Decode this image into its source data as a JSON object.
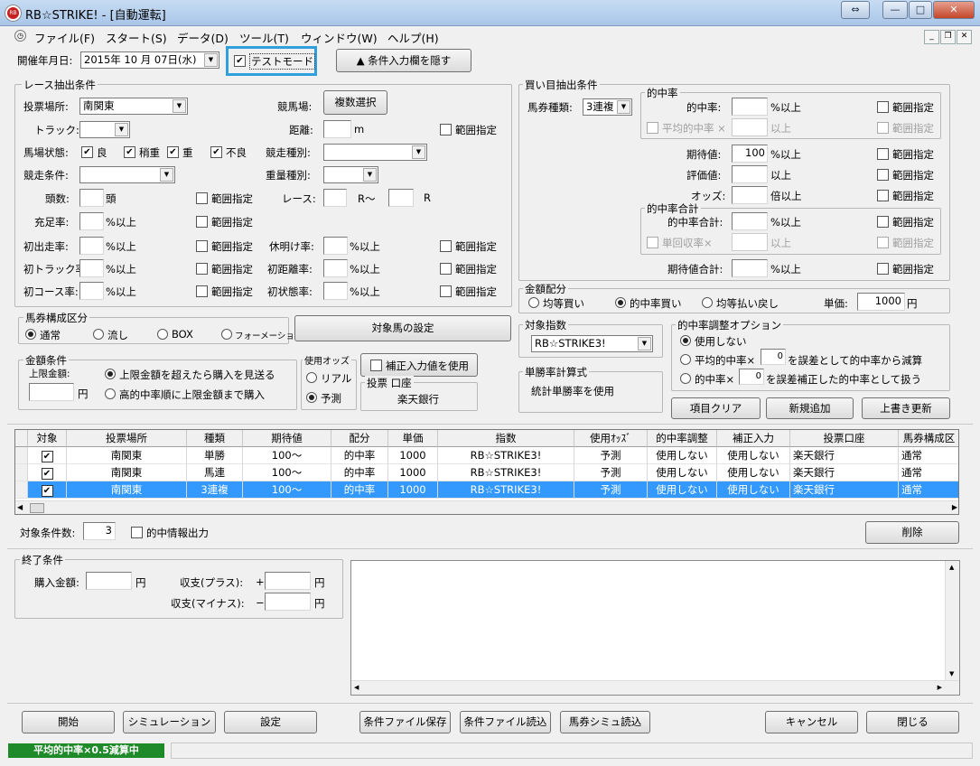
{
  "window": {
    "title": "RB☆STRIKE! - [自動運転]",
    "logo_text": "RB"
  },
  "menu": [
    "ファイル(F)",
    "スタート(S)",
    "データ(D)",
    "ツール(T)",
    "ウィンドウ(W)",
    "ヘルプ(H)"
  ],
  "top": {
    "date_label": "開催年月日:",
    "date_value": "2015年 10 月 07日(水)",
    "test_mode_label": "テストモード",
    "hide_btn": "▲ 条件入力欄を隠す"
  },
  "race": {
    "group": "レース抽出条件",
    "venue_label": "投票場所:",
    "venue_value": "南関東",
    "keibajo_label": "競馬場:",
    "multi_btn": "複数選択",
    "track_label": "トラック:",
    "distance_label": "距離:",
    "distance_unit": "m",
    "range_label": "範囲指定",
    "baba_label": "馬場状態:",
    "baba_opts": [
      "良",
      "稍重",
      "重",
      "不良"
    ],
    "shubetsu_label": "競走種別:",
    "joken_label": "競走条件:",
    "juryo_label": "重量種別:",
    "tosu_label": "頭数:",
    "tosu_unit": "頭",
    "race_label": "レース:",
    "race_r1": "R～",
    "race_r2": "R",
    "jusoku_label": "充足率:",
    "pct_unit": "%以上",
    "shoshutsu_label": "初出走率:",
    "kyumeake_label": "休明け率:",
    "shotrack_label": "初トラック率:",
    "shokyori_label": "初距離率:",
    "shocourse_label": "初コース率:",
    "shojotai_label": "初状態率:"
  },
  "buy": {
    "group": "買い目抽出条件",
    "baken_label": "馬券種類:",
    "baken_value": "3連複",
    "hit_group": "的中率",
    "hit_label": "的中率:",
    "hit_unit": "%以上",
    "avg_hit_label": "平均的中率 ×",
    "avg_hit_unit": "以上",
    "range_label": "範囲指定",
    "expect_label": "期待値:",
    "expect_value": "100",
    "expect_unit": "%以上",
    "eval_label": "評価値:",
    "eval_unit": "以上",
    "odds_label": "オッズ:",
    "odds_unit": "倍以上",
    "total_group": "的中率合計",
    "total_label": "的中率合計:",
    "total_unit": "%以上",
    "single_avg_label": "単回収率×",
    "single_avg_unit": "以上",
    "expect_total_label": "期待値合計:",
    "expect_total_unit": "%以上"
  },
  "money": {
    "group": "金額配分",
    "opts": [
      "均等買い",
      "的中率買い",
      "均等払い戻し"
    ],
    "unit_label": "単価:",
    "unit_value": "1000",
    "unit_yen": "円"
  },
  "bakenkosei": {
    "group": "馬券構成区分",
    "opts": [
      "通常",
      "流し",
      "BOX",
      "フォーメーション"
    ],
    "target_btn": "対象馬の設定"
  },
  "amount": {
    "group": "金額条件",
    "limit_label": "上限金額:",
    "yen": "円",
    "opt1": "上限金額を超えたら購入を見送る",
    "opt2": "高的中率順に上限金額まで購入"
  },
  "odds": {
    "group": "使用オッズ",
    "opts": [
      "リアル",
      "予測"
    ],
    "hosei_label": "補正入力値を使用",
    "account_group": "投票 口座",
    "account_value": "楽天銀行"
  },
  "index": {
    "group": "対象指数",
    "value": "RB☆STRIKE3!"
  },
  "winrate": {
    "group": "単勝率計算式",
    "value": "統計単勝率を使用"
  },
  "adjust": {
    "group": "的中率調整オプション",
    "opt1": "使用しない",
    "opt2a": "平均的中率×",
    "opt2b": "を誤差として的中率から減算",
    "opt3a": "的中率×",
    "opt3b": "を誤差補正した的中率として扱う",
    "val2": "0",
    "val3": "0"
  },
  "actions": {
    "clear": "項目クリア",
    "add": "新規追加",
    "overwrite": "上書き更新"
  },
  "table": {
    "headers": [
      "対象",
      "投票場所",
      "種類",
      "期待値",
      "配分",
      "単価",
      "指数",
      "使用ｵｯｽﾞ",
      "的中率調整",
      "補正入力",
      "投票口座",
      "馬券構成区"
    ],
    "rows": [
      [
        "南関東",
        "単勝",
        "100～",
        "的中率",
        "1000",
        "RB☆STRIKE3!",
        "予測",
        "使用しない",
        "使用しない",
        "楽天銀行",
        "通常"
      ],
      [
        "南関東",
        "馬連",
        "100～",
        "的中率",
        "1000",
        "RB☆STRIKE3!",
        "予測",
        "使用しない",
        "使用しない",
        "楽天銀行",
        "通常"
      ],
      [
        "南関東",
        "3連複",
        "100～",
        "的中率",
        "1000",
        "RB☆STRIKE3!",
        "予測",
        "使用しない",
        "使用しない",
        "楽天銀行",
        "通常"
      ]
    ],
    "selected_row": 2
  },
  "count": {
    "label": "対象条件数:",
    "value": "3",
    "info_label": "的中情報出力",
    "delete_btn": "削除"
  },
  "end": {
    "group": "終了条件",
    "purchase_label": "購入金額:",
    "plus_label": "収支(プラス):",
    "plus_sign": "+",
    "minus_label": "収支(マイナス):",
    "minus_sign": "−",
    "yen": "円"
  },
  "bottom": {
    "start": "開始",
    "sim": "シミュレーション",
    "settings": "設定",
    "save": "条件ファイル保存",
    "load": "条件ファイル読込",
    "bakensim": "馬券シミュ読込",
    "cancel": "キャンセル",
    "close": "閉じる"
  },
  "status": {
    "text": "平均的中率×0.5減算中"
  },
  "colors": {
    "highlight": "#2fa0dc",
    "selection": "#3399ff",
    "status_bg": "#1f8a2a"
  }
}
